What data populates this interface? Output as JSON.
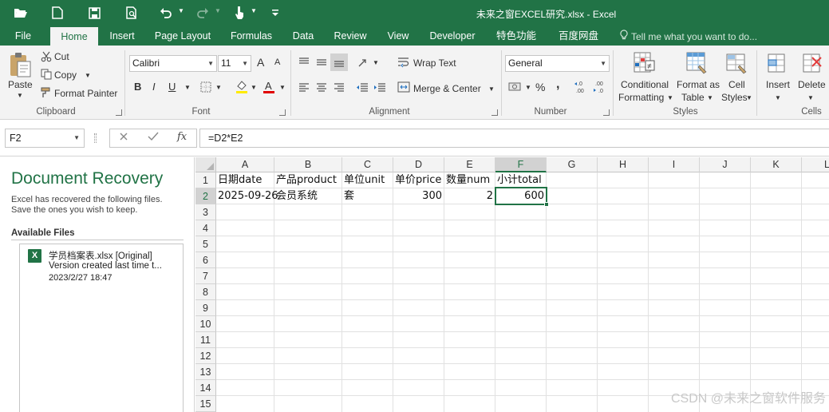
{
  "window": {
    "title": "未来之窗EXCEL研究.xlsx - Excel"
  },
  "qat": {
    "icons": [
      "folder-open-icon",
      "new-file-icon",
      "save-icon",
      "print-preview-icon",
      "undo-icon",
      "redo-icon",
      "touch-mode-icon",
      "customize-qat-icon"
    ]
  },
  "tabs": [
    "File",
    "Home",
    "Insert",
    "Page Layout",
    "Formulas",
    "Data",
    "Review",
    "View",
    "Developer",
    "特色功能",
    "百度网盘"
  ],
  "active_tab": "Home",
  "tell_me": {
    "placeholder": "Tell me what you want to do..."
  },
  "ribbon": {
    "clipboard": {
      "label": "Clipboard",
      "paste": "Paste",
      "cut": "Cut",
      "copy": "Copy",
      "format_painter": "Format Painter"
    },
    "font": {
      "label": "Font",
      "family": "Calibri",
      "size": "11",
      "bold": "B",
      "italic": "I",
      "underline": "U",
      "grow": "A",
      "shrink": "A"
    },
    "alignment": {
      "label": "Alignment",
      "wrap_text": "Wrap Text",
      "merge_center": "Merge & Center"
    },
    "number": {
      "label": "Number",
      "format": "General",
      "percent": "%",
      "comma": ","
    },
    "styles": {
      "label": "Styles",
      "conditional": [
        "Conditional",
        "Formatting"
      ],
      "format_table": [
        "Format as",
        "Table"
      ],
      "cell_styles": [
        "Cell",
        "Styles"
      ]
    },
    "cells": {
      "label": "Cells",
      "insert": "Insert",
      "delete": "Delete"
    }
  },
  "formula_bar": {
    "name_box": "F2",
    "fx": "fx",
    "formula": "=D2*E2"
  },
  "recovery": {
    "title": "Document Recovery",
    "description": "Excel has recovered the following files. Save the ones you wish to keep.",
    "available_label": "Available Files",
    "file": {
      "name": "学员档案表.xlsx  [Original]",
      "version": "Version created last time t...",
      "date": "2023/2/27 18:47"
    }
  },
  "sheet": {
    "columns": [
      "A",
      "B",
      "C",
      "D",
      "E",
      "F",
      "G",
      "H",
      "I",
      "J",
      "K",
      "L"
    ],
    "rows": [
      "1",
      "2",
      "3",
      "4",
      "5",
      "6",
      "7",
      "8",
      "9",
      "10",
      "11",
      "12",
      "13",
      "14",
      "15"
    ],
    "selected_cell": "F2",
    "cells": {
      "A1": "日期date",
      "B1": "产品product",
      "C1": "单位unit",
      "D1": "单价price",
      "E1": "数量num",
      "F1": "小计total",
      "A2": "2025-09-26",
      "B2": "会员系统",
      "C2": "套",
      "D2": "300",
      "E2": "2",
      "F2": "600"
    }
  },
  "watermark": "CSDN @未来之窗软件服务"
}
